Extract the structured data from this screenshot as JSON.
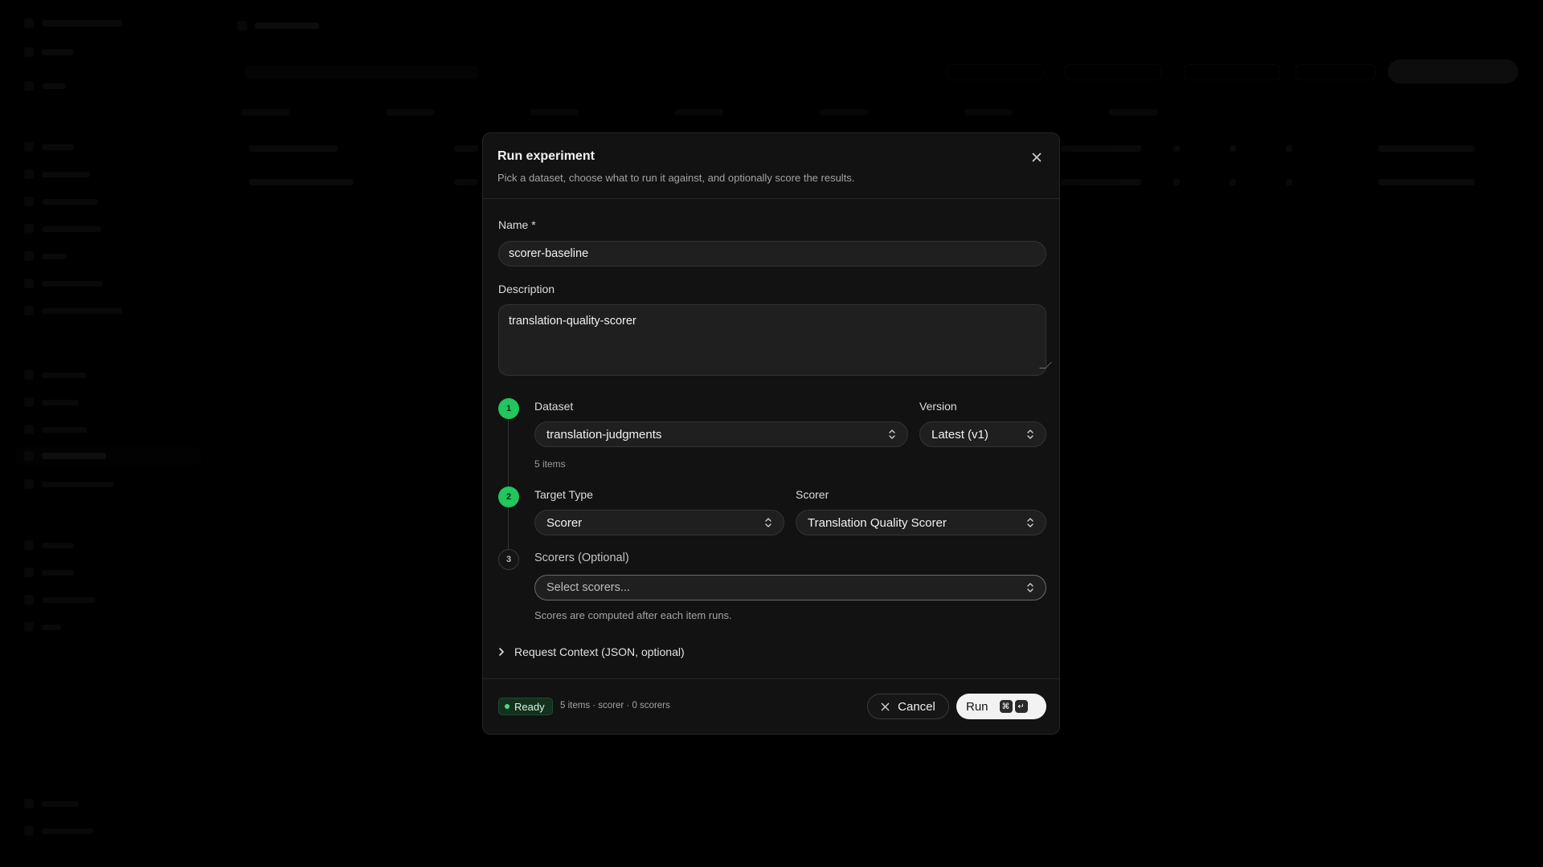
{
  "modal": {
    "title": "Run experiment",
    "subtitle": "Pick a dataset, choose what to run it against, and optionally score the results.",
    "name_label": "Name *",
    "name_value": "scorer-baseline",
    "description_label": "Description",
    "description_value": "translation-quality-scorer",
    "steps": [
      {
        "number": "1",
        "state": "complete"
      },
      {
        "number": "2",
        "state": "complete"
      },
      {
        "number": "3",
        "state": "pending"
      }
    ],
    "dataset_label": "Dataset",
    "dataset_value": "translation-judgments",
    "dataset_hint": "5 items",
    "version_label": "Version",
    "version_value": "Latest (v1)",
    "target_type_label": "Target Type",
    "target_type_value": "Scorer",
    "scorer_label": "Scorer",
    "scorer_value": "Translation Quality Scorer",
    "scorers_label": "Scorers (Optional)",
    "scorers_placeholder": "Select scorers...",
    "scorers_hint": "Scores are computed after each item runs.",
    "request_context_label": "Request Context (JSON, optional)"
  },
  "footer": {
    "status": "Ready",
    "summary": "5 items · scorer · 0 scorers",
    "cancel_label": "Cancel",
    "run_label": "Run",
    "shortcut_keys": [
      "⌘",
      "↵"
    ]
  },
  "colors": {
    "accent_green": "#22c55e",
    "modal_bg": "#121212",
    "input_bg": "#1f1f1f"
  }
}
